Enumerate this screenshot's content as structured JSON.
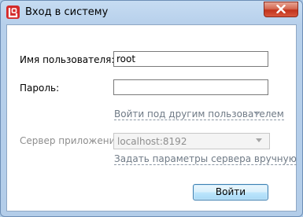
{
  "window": {
    "title": "Вход в систему"
  },
  "form": {
    "username_label": "Имя пользователя:",
    "username_value": "root",
    "password_label": "Пароль:",
    "password_value": "",
    "other_user_link": "Войти под другим пользователем",
    "server_label": "Сервер приложений:",
    "server_value": "localhost:8192",
    "server_manual_link": "Задать параметры сервера вручную",
    "login_button": "Войти"
  },
  "colors": {
    "accent": "#d42a2a",
    "close_button": "#c2331b",
    "link": "#6f7a86",
    "disabled_text": "#8e8e8e"
  },
  "icons": {
    "app": "app-logo-icon",
    "close": "close-icon",
    "chevron": "chevron-down-icon",
    "dropdown": "dropdown-arrow-icon"
  }
}
